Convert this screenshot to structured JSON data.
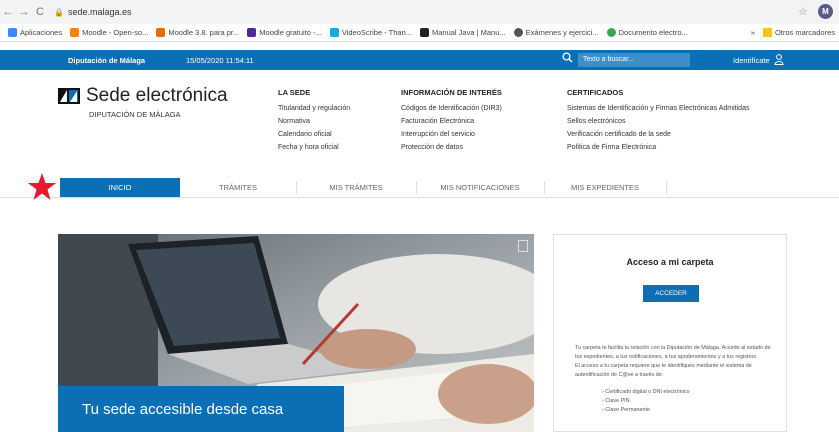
{
  "browser": {
    "url": "sede.malaga.es",
    "profile_initial": "M",
    "bookmarks": [
      {
        "label": "Aplicaciones",
        "icon": "apps-grid-icon",
        "color": "#4285f4"
      },
      {
        "label": "Moodle - Open-so...",
        "icon": "moodle-icon",
        "color": "#f98012"
      },
      {
        "label": "Moodle 3.8. para pr...",
        "icon": "moodle-wing-icon",
        "color": "#e46c0a"
      },
      {
        "label": "Moodle gratuito -...",
        "icon": "moodle-site-icon",
        "color": "#4a2a8a"
      },
      {
        "label": "VideoScribe - Than...",
        "icon": "videoscribe-icon",
        "color": "#1ea6e3"
      },
      {
        "label": "Manual Java | Manu...",
        "icon": "book-icon",
        "color": "#222222"
      },
      {
        "label": "Exámenes y ejercici...",
        "icon": "globe-icon",
        "color": "#555555"
      },
      {
        "label": "Documento electro...",
        "icon": "document-icon",
        "color": "#34a853"
      }
    ],
    "more": "»",
    "other_bookmarks": "Otros marcadores"
  },
  "topbar": {
    "org": "Diputación de Málaga",
    "datetime": "15/05/2020 11:54:11",
    "search_placeholder": "Texto a buscar...",
    "login": "Identifícate"
  },
  "header": {
    "title": "Sede electrónica",
    "subtitle": "DIPUTACIÓN DE MÁLAGA",
    "columns": [
      {
        "heading": "LA SEDE",
        "links": [
          "Titularidad y regulación",
          "Normativa",
          "Calendario oficial",
          "Fecha y hora oficial"
        ]
      },
      {
        "heading": "INFORMACIÓN DE INTERÉS",
        "links": [
          "Códigos de Identificación (DIR3)",
          "Facturación Electrónica",
          "Interrupción del servicio",
          "Protección de datos"
        ]
      },
      {
        "heading": "CERTIFICADOS",
        "links": [
          "Sistemas de Identificación y Firmas Electrónicas Admitidas",
          "Sellos electrónicos",
          "Verificación certificado de la sede",
          "Política de Firma Electrónica"
        ]
      }
    ]
  },
  "tabs": [
    "INICIO",
    "TRÁMITES",
    "MIS TRÁMITES",
    "MIS NOTIFICACIONES",
    "MIS EXPEDIENTES"
  ],
  "hero": {
    "caption": "Tu sede accesible desde casa"
  },
  "panel": {
    "title": "Acceso a mi carpeta",
    "button": "ACCEDER",
    "text1": "Tu carpeta te facilita la relación con la Diputación de Málaga. Accede al estado de tus expedientes, a tus notificaciones, a tus apoderamientos y a tus registros.",
    "text2": "El acceso a tu carpeta requiere que te identifiques mediante el sistema de autentificación de C@ve a través de:",
    "list": [
      "Certificado digital o DNI electrónico",
      "Clave PIN",
      "Clave Permanente"
    ]
  },
  "colors": {
    "brand": "#0b6fb6",
    "highlight": "#e8192c"
  }
}
